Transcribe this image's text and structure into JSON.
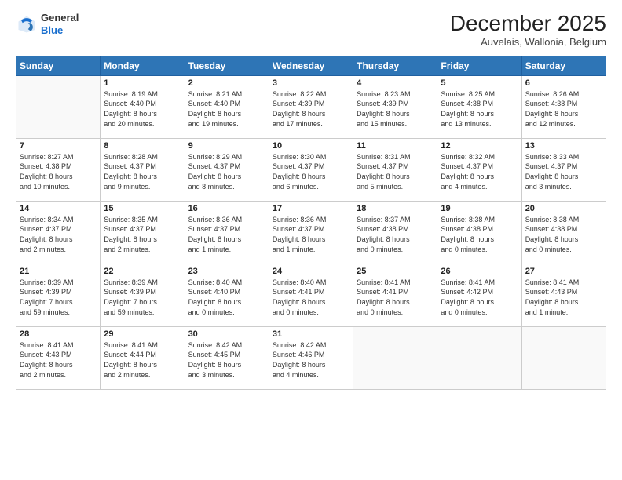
{
  "header": {
    "logo": {
      "general": "General",
      "blue": "Blue"
    },
    "title": "December 2025",
    "location": "Auvelais, Wallonia, Belgium"
  },
  "calendar": {
    "days_of_week": [
      "Sunday",
      "Monday",
      "Tuesday",
      "Wednesday",
      "Thursday",
      "Friday",
      "Saturday"
    ],
    "weeks": [
      [
        {
          "day": "",
          "info": ""
        },
        {
          "day": "1",
          "info": "Sunrise: 8:19 AM\nSunset: 4:40 PM\nDaylight: 8 hours\nand 20 minutes."
        },
        {
          "day": "2",
          "info": "Sunrise: 8:21 AM\nSunset: 4:40 PM\nDaylight: 8 hours\nand 19 minutes."
        },
        {
          "day": "3",
          "info": "Sunrise: 8:22 AM\nSunset: 4:39 PM\nDaylight: 8 hours\nand 17 minutes."
        },
        {
          "day": "4",
          "info": "Sunrise: 8:23 AM\nSunset: 4:39 PM\nDaylight: 8 hours\nand 15 minutes."
        },
        {
          "day": "5",
          "info": "Sunrise: 8:25 AM\nSunset: 4:38 PM\nDaylight: 8 hours\nand 13 minutes."
        },
        {
          "day": "6",
          "info": "Sunrise: 8:26 AM\nSunset: 4:38 PM\nDaylight: 8 hours\nand 12 minutes."
        }
      ],
      [
        {
          "day": "7",
          "info": "Sunrise: 8:27 AM\nSunset: 4:38 PM\nDaylight: 8 hours\nand 10 minutes."
        },
        {
          "day": "8",
          "info": "Sunrise: 8:28 AM\nSunset: 4:37 PM\nDaylight: 8 hours\nand 9 minutes."
        },
        {
          "day": "9",
          "info": "Sunrise: 8:29 AM\nSunset: 4:37 PM\nDaylight: 8 hours\nand 8 minutes."
        },
        {
          "day": "10",
          "info": "Sunrise: 8:30 AM\nSunset: 4:37 PM\nDaylight: 8 hours\nand 6 minutes."
        },
        {
          "day": "11",
          "info": "Sunrise: 8:31 AM\nSunset: 4:37 PM\nDaylight: 8 hours\nand 5 minutes."
        },
        {
          "day": "12",
          "info": "Sunrise: 8:32 AM\nSunset: 4:37 PM\nDaylight: 8 hours\nand 4 minutes."
        },
        {
          "day": "13",
          "info": "Sunrise: 8:33 AM\nSunset: 4:37 PM\nDaylight: 8 hours\nand 3 minutes."
        }
      ],
      [
        {
          "day": "14",
          "info": "Sunrise: 8:34 AM\nSunset: 4:37 PM\nDaylight: 8 hours\nand 2 minutes."
        },
        {
          "day": "15",
          "info": "Sunrise: 8:35 AM\nSunset: 4:37 PM\nDaylight: 8 hours\nand 2 minutes."
        },
        {
          "day": "16",
          "info": "Sunrise: 8:36 AM\nSunset: 4:37 PM\nDaylight: 8 hours\nand 1 minute."
        },
        {
          "day": "17",
          "info": "Sunrise: 8:36 AM\nSunset: 4:37 PM\nDaylight: 8 hours\nand 1 minute."
        },
        {
          "day": "18",
          "info": "Sunrise: 8:37 AM\nSunset: 4:38 PM\nDaylight: 8 hours\nand 0 minutes."
        },
        {
          "day": "19",
          "info": "Sunrise: 8:38 AM\nSunset: 4:38 PM\nDaylight: 8 hours\nand 0 minutes."
        },
        {
          "day": "20",
          "info": "Sunrise: 8:38 AM\nSunset: 4:38 PM\nDaylight: 8 hours\nand 0 minutes."
        }
      ],
      [
        {
          "day": "21",
          "info": "Sunrise: 8:39 AM\nSunset: 4:39 PM\nDaylight: 7 hours\nand 59 minutes."
        },
        {
          "day": "22",
          "info": "Sunrise: 8:39 AM\nSunset: 4:39 PM\nDaylight: 7 hours\nand 59 minutes."
        },
        {
          "day": "23",
          "info": "Sunrise: 8:40 AM\nSunset: 4:40 PM\nDaylight: 8 hours\nand 0 minutes."
        },
        {
          "day": "24",
          "info": "Sunrise: 8:40 AM\nSunset: 4:41 PM\nDaylight: 8 hours\nand 0 minutes."
        },
        {
          "day": "25",
          "info": "Sunrise: 8:41 AM\nSunset: 4:41 PM\nDaylight: 8 hours\nand 0 minutes."
        },
        {
          "day": "26",
          "info": "Sunrise: 8:41 AM\nSunset: 4:42 PM\nDaylight: 8 hours\nand 0 minutes."
        },
        {
          "day": "27",
          "info": "Sunrise: 8:41 AM\nSunset: 4:43 PM\nDaylight: 8 hours\nand 1 minute."
        }
      ],
      [
        {
          "day": "28",
          "info": "Sunrise: 8:41 AM\nSunset: 4:43 PM\nDaylight: 8 hours\nand 2 minutes."
        },
        {
          "day": "29",
          "info": "Sunrise: 8:41 AM\nSunset: 4:44 PM\nDaylight: 8 hours\nand 2 minutes."
        },
        {
          "day": "30",
          "info": "Sunrise: 8:42 AM\nSunset: 4:45 PM\nDaylight: 8 hours\nand 3 minutes."
        },
        {
          "day": "31",
          "info": "Sunrise: 8:42 AM\nSunset: 4:46 PM\nDaylight: 8 hours\nand 4 minutes."
        },
        {
          "day": "",
          "info": ""
        },
        {
          "day": "",
          "info": ""
        },
        {
          "day": "",
          "info": ""
        }
      ]
    ]
  }
}
